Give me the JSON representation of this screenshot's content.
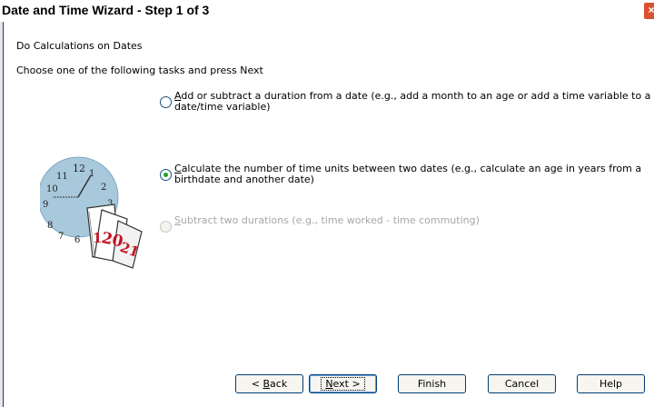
{
  "window": {
    "title": "Date and Time Wizard - Step 1 of 3",
    "close_glyph": "×"
  },
  "heading": "Do Calculations on Dates",
  "instructions": "Choose one of the following tasks and press Next",
  "options": [
    {
      "mnemonic": "A",
      "rest": "dd or subtract a duration from a date (e.g., add a month to an age or add a time variable to a date/time variable)",
      "selected": false,
      "enabled": true
    },
    {
      "mnemonic": "C",
      "rest": "alculate the number of time units between two dates (e.g., calculate an age in years from a birthdate and another date)",
      "selected": true,
      "enabled": true
    },
    {
      "mnemonic": "S",
      "rest": "ubtract two durations (e.g., time worked - time commuting)",
      "selected": false,
      "enabled": false
    }
  ],
  "illustration": {
    "icon": "clock-and-calendar-icon",
    "clock_numbers": [
      "12",
      "1",
      "2",
      "3",
      "6",
      "7",
      "8",
      "9",
      "10",
      "11"
    ],
    "calendar_pages": [
      "1",
      "20",
      "21"
    ]
  },
  "buttons": {
    "back_pre": "< ",
    "back_mnemonic": "B",
    "back_post": "ack",
    "next_mnemonic": "N",
    "next_post": "ext >",
    "finish": "Finish",
    "cancel": "Cancel",
    "help": "Help"
  },
  "colors": {
    "accent": "#0831d9",
    "radio_selected": "#21a121",
    "calendar_red": "#c0121e",
    "clock_face": "#a8c8dc"
  }
}
